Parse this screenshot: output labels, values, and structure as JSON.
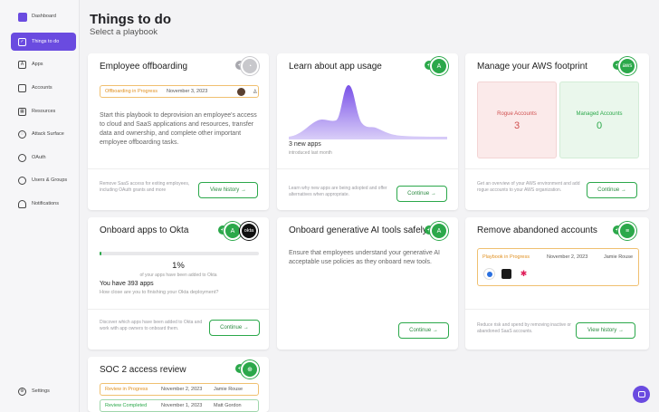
{
  "sidebar": {
    "brand": "Dashboard",
    "items": [
      {
        "label": "Things to do",
        "icon": "check-square-icon",
        "active": true
      },
      {
        "label": "Apps",
        "icon": "apps-icon"
      },
      {
        "label": "Accounts",
        "icon": "accounts-icon"
      },
      {
        "label": "Resources",
        "icon": "resources-icon"
      },
      {
        "label": "Attack Surface",
        "icon": "attack-surface-icon"
      },
      {
        "label": "OAuth",
        "icon": "oauth-icon"
      },
      {
        "label": "Users & Groups",
        "icon": "users-icon"
      },
      {
        "label": "Notifications",
        "icon": "bell-icon"
      }
    ],
    "settings": "Settings"
  },
  "page": {
    "title": "Things to do",
    "subtitle": "Select a playbook"
  },
  "cards": {
    "offboarding": {
      "title": "Employee offboarding",
      "status": "Offboarding in Progress",
      "date": "November 3, 2023",
      "desc": "Start this playbook to deprovision an employee's access to cloud and SaaS applications and resources, transfer data and ownership, and complete other important employee offboarding tasks.",
      "foot": "Remove SaaS access for exiting employees, including OAuth grants and more",
      "button": "View history"
    },
    "usage": {
      "title": "Learn about app usage",
      "stat": "3 new apps",
      "sub": "introduced last month",
      "foot": "Learn why new apps are being adopted and offer alternatives when appropriate.",
      "button": "Continue",
      "aws_label": "aws"
    },
    "aws": {
      "title": "Manage your AWS footprint",
      "rogue_label": "Rogue Accounts",
      "rogue_value": "3",
      "managed_label": "Managed Accounts",
      "managed_value": "0",
      "foot": "Get an overview of your AWS environment and add rogue accounts to your AWS organization.",
      "button": "Continue",
      "badge": "aws"
    },
    "okta": {
      "title": "Onboard apps to Okta",
      "percent": "1%",
      "percent_sub": "of your apps have been added to Okta",
      "progress": 0.01,
      "apps": "You have 393 apps",
      "apps_sub": "How close are you to finishing your Okta deployment?",
      "foot": "Discover which apps have been added to Okta and work with app owners to onboard them.",
      "button": "Continue",
      "badge": "okta"
    },
    "genai": {
      "title": "Onboard generative AI tools safely",
      "desc": "Ensure that employees understand your generative AI acceptable use policies as they onboard new tools.",
      "button": "Continue"
    },
    "abandoned": {
      "title": "Remove abandoned accounts",
      "status": "Playbook in Progress",
      "date": "November 2, 2023",
      "name": "Jamie Rouse",
      "foot": "Reduce risk and spend by removing inactive or abandoned SaaS accounts.",
      "button": "View history"
    },
    "soc2": {
      "title": "SOC 2 access review",
      "rows": [
        {
          "status": "Review in Progress",
          "date": "November 2, 2023",
          "name": "Jamie Rouse"
        },
        {
          "status": "Review Completed",
          "date": "November 1, 2023",
          "name": "Matt Gordon"
        }
      ]
    }
  }
}
